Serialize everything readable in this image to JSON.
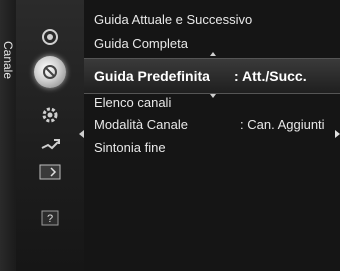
{
  "category": {
    "label": "Canale"
  },
  "sidebar": {
    "icons": [
      {
        "name": "antenna-icon"
      },
      {
        "name": "channel-satellite-icon"
      },
      {
        "name": "gear-icon"
      },
      {
        "name": "plug-icon"
      },
      {
        "name": "screen-icon"
      },
      {
        "name": "help-icon",
        "glyph": "?"
      }
    ]
  },
  "menu": {
    "items": [
      {
        "label": "Guida Attuale e Successivo",
        "value": ""
      },
      {
        "label": "Guida Completa",
        "value": ""
      },
      {
        "label": "Guida Predefinita",
        "value": ": Att./Succ."
      },
      {
        "label": "Elenco canali",
        "value": ""
      },
      {
        "label": "Modalità Canale",
        "value": ": Can. Aggiunti"
      },
      {
        "label": "Sintonia fine",
        "value": ""
      }
    ]
  },
  "colors": {
    "text": "#e8e8e8",
    "selected_text": "#ffffff",
    "background": "#151515"
  }
}
